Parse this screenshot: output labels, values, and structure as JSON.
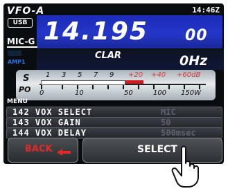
{
  "display": {
    "vfo": "VFO-A",
    "time": "14:46Z",
    "mode": "USB",
    "frequency_main": "14.195",
    "frequency_small": "00",
    "mic_gain_label": "MIC-G",
    "amp_label": "AMP1",
    "clar_label": "CLAR",
    "clar_value": "0Hz"
  },
  "meter": {
    "s_label": "S",
    "po_label": "PO",
    "s_scale": [
      "1",
      "3",
      "5",
      "7",
      "9",
      "+20",
      "+40",
      "+60dB"
    ],
    "po_scale": [
      "0",
      "10",
      "50",
      "100",
      "150W"
    ],
    "s_level_fraction": 0.62
  },
  "menu": {
    "title": "MENU",
    "items": [
      {
        "number_label": "142 VOX SELECT",
        "value": "MIC"
      },
      {
        "number_label": "143 VOX GAIN",
        "value": "50"
      },
      {
        "number_label": "144 VOX DELAY",
        "value": "500msec"
      }
    ]
  },
  "buttons": {
    "back": "BACK",
    "select": "SELECT"
  },
  "colors": {
    "freq_bg": "#2436c8",
    "back_text": "#e02a2a",
    "s_peak": "#d41b1b"
  }
}
